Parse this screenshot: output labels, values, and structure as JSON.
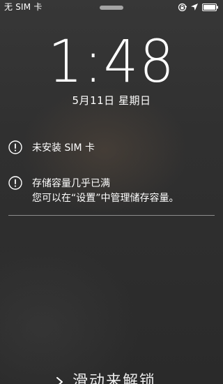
{
  "status_bar": {
    "carrier": "无 SIM 卡",
    "icons": [
      "orientation-lock-icon",
      "location-arrow-icon",
      "battery-icon"
    ]
  },
  "lock_screen": {
    "time": "1:48",
    "date": "5月11日  星期日"
  },
  "notifications": [
    {
      "icon": "alert-icon",
      "title": "未安装 SIM 卡",
      "body": ""
    },
    {
      "icon": "alert-icon",
      "title": "存储容量几乎已满",
      "body": "您可以在“设置”中管理储存容量。"
    }
  ],
  "unlock": {
    "label": "滑动来解锁"
  }
}
